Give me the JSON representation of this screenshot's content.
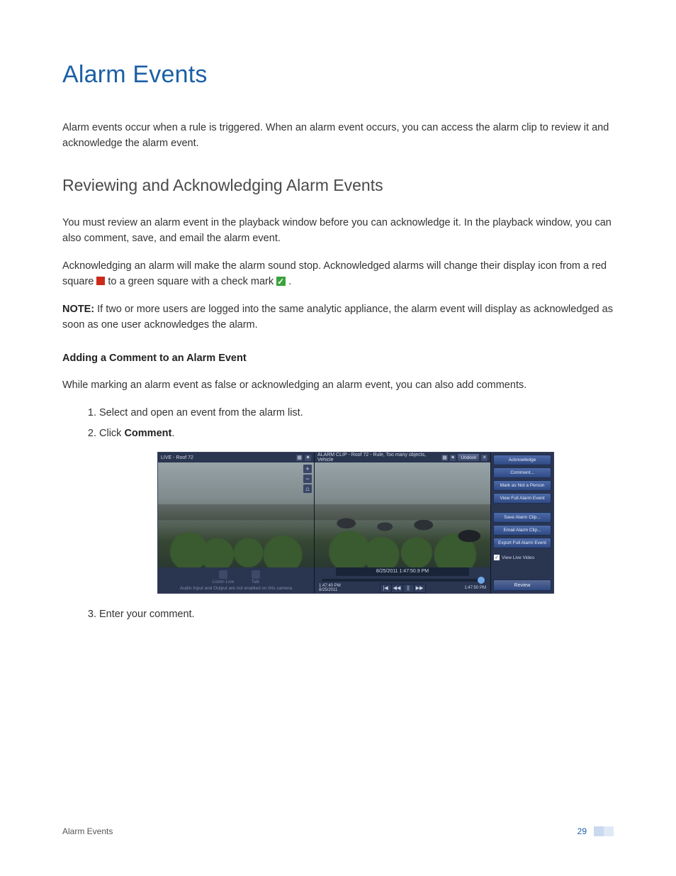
{
  "page": {
    "title": "Alarm Events",
    "intro": "Alarm events occur when a rule is triggered. When an alarm event occurs, you can access the alarm clip to review it and acknowledge the alarm event.",
    "section_title": "Reviewing and Acknowledging Alarm Events",
    "p1": "You must review an alarm event in the playback window before you can acknowledge it. In the playback window, you can also comment, save, and email the alarm event.",
    "p2_a": "Acknowledging an alarm will make the alarm sound stop. Acknowledged alarms will change their display icon from a red square ",
    "p2_b": " to a green square with a check mark ",
    "p2_c": ".",
    "note_label": "NOTE:",
    "note_body": " If two or more users are logged into the same analytic appliance, the alarm event will display as acknowledged as soon as one user acknowledges the alarm.",
    "add_comment_title": "Adding a Comment to an Alarm Event",
    "add_comment_intro": "While marking an alarm event as false or acknowledging an alarm event, you can also add comments.",
    "steps": [
      "Select and open an event from the alarm list.",
      "Click ",
      "Enter your comment."
    ],
    "step2_bold": "Comment",
    "step2_suffix": "."
  },
  "screenshot": {
    "left_title": "LIVE - Roof 72",
    "clip_title": "ALARM CLIP - Roof 72 - Rule, Too many objects, Vehicle",
    "undock": "Undock",
    "zoom": {
      "plus": "+",
      "minus": "−",
      "home": "⌂"
    },
    "live_controls": {
      "listen": "Listen Live",
      "talk": "Talk",
      "disabled_msg": "Audio Input and Output are not enabled on this camera"
    },
    "playback": {
      "timestamp_label": "8/25/2011 1:47:50.9 PM",
      "start_time": "1:47:40 PM",
      "start_date": "8/25/2011",
      "end_time": "1:47:50 PM",
      "controls": {
        "first": "|◀",
        "rew": "◀◀",
        "pause": "||",
        "fwd": "▶▶"
      }
    },
    "side_buttons": [
      "Acknowledge",
      "Comment...",
      "Mark as Not a Person",
      "View Full Alarm Event",
      "Save Alarm Clip...",
      "Email Alarm Clip...",
      "Export Full Alarm Event"
    ],
    "view_live_video": "View Live Video",
    "review": "Review"
  },
  "footer": {
    "section": "Alarm Events",
    "page_number": "29"
  }
}
